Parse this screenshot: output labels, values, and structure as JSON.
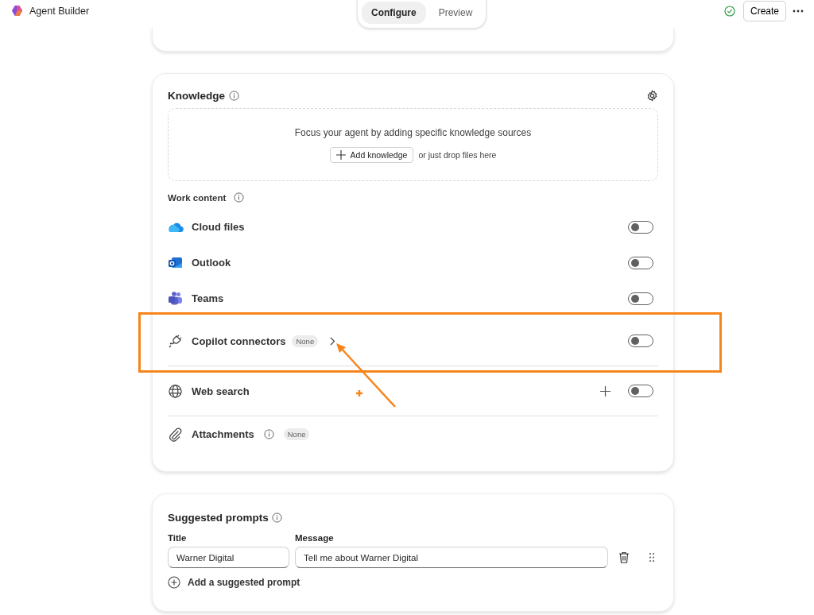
{
  "app": {
    "name": "Agent Builder"
  },
  "mode_tabs": [
    {
      "label": "Configure",
      "selected": true
    },
    {
      "label": "Preview",
      "selected": false
    }
  ],
  "create_button": "Create",
  "knowledge": {
    "title": "Knowledge",
    "drop_hint": "Focus your agent by adding specific knowledge sources",
    "add_button": "Add knowledge",
    "drop_text": "or just drop files here",
    "work_content_label": "Work content",
    "sources": [
      {
        "kind": "cloud",
        "label": "Cloud files",
        "on": false
      },
      {
        "kind": "outlook",
        "label": "Outlook",
        "on": false
      },
      {
        "kind": "teams",
        "label": "Teams",
        "on": false
      },
      {
        "kind": "connector",
        "label": "Copilot connectors",
        "badge": "None",
        "on": false,
        "highlighted": true
      },
      {
        "kind": "web",
        "label": "Web search",
        "on": false
      },
      {
        "kind": "attachment",
        "label": "Attachments",
        "badge": "None"
      }
    ]
  },
  "suggested_prompts": {
    "title": "Suggested prompts",
    "columns": [
      "Title",
      "Message"
    ],
    "prompts": [
      {
        "title": "Warner Digital",
        "message": "Tell me about Warner Digital"
      }
    ],
    "add_label": "Add a suggested prompt"
  }
}
